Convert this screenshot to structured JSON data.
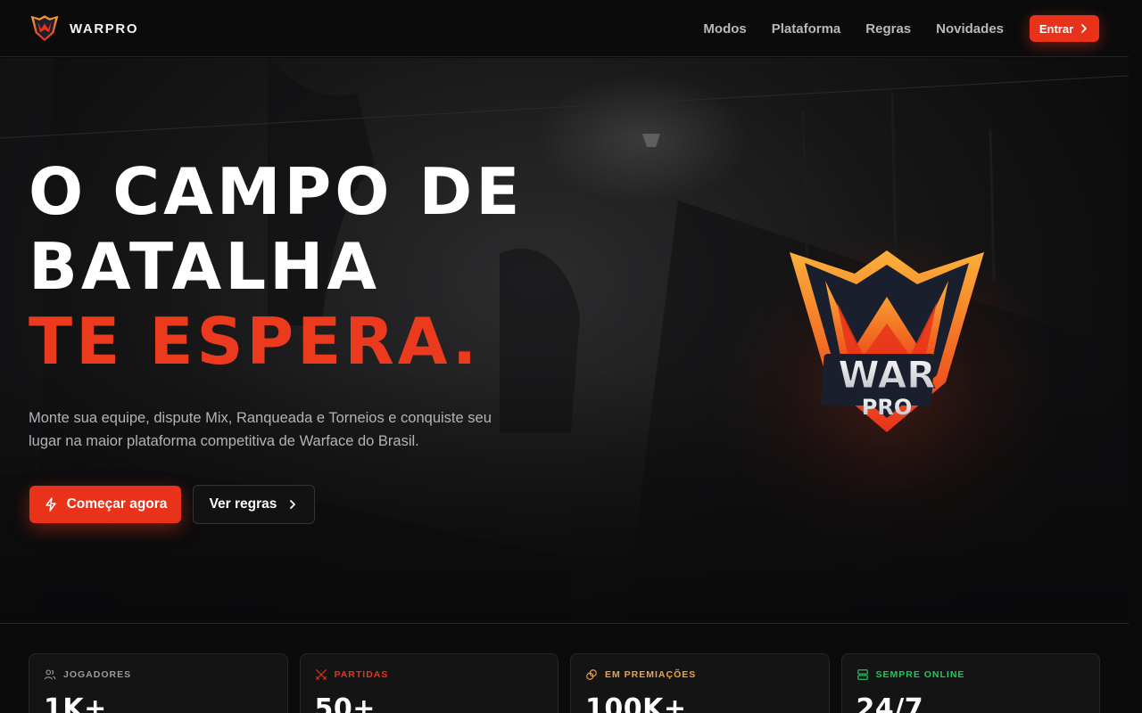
{
  "nav": {
    "brand": "WARPRO",
    "links": [
      "Modos",
      "Plataforma",
      "Regras",
      "Novidades"
    ],
    "enter_label": "Entrar"
  },
  "hero": {
    "headline_line1": "O CAMPO DE",
    "headline_line2": "BATALHA",
    "headline_line3": "TE ESPERA.",
    "subtext": "Monte sua equipe, dispute Mix, Ranqueada e Torneios e conquiste seu lugar na maior plataforma competitiva de Warface do Brasil.",
    "primary_cta": "Começar agora",
    "secondary_cta": "Ver regras",
    "logo_text_top": "WAR",
    "logo_text_bottom": "PRO"
  },
  "stats": [
    {
      "label": "JOGADORES",
      "value": "1K+",
      "icon": "users-icon",
      "color": "#9a9aa0"
    },
    {
      "label": "PARTIDAS",
      "value": "50+",
      "icon": "crossed-swords-icon",
      "color": "#e8321a"
    },
    {
      "label": "EM PREMIAÇÕES",
      "value": "100K+",
      "icon": "coins-icon",
      "color": "#f2a33a"
    },
    {
      "label": "SEMPRE ONLINE",
      "value": "24/7",
      "icon": "server-icon",
      "color": "#22c55e"
    }
  ],
  "colors": {
    "accent": "#e8321a",
    "background": "#0b0b0c"
  }
}
